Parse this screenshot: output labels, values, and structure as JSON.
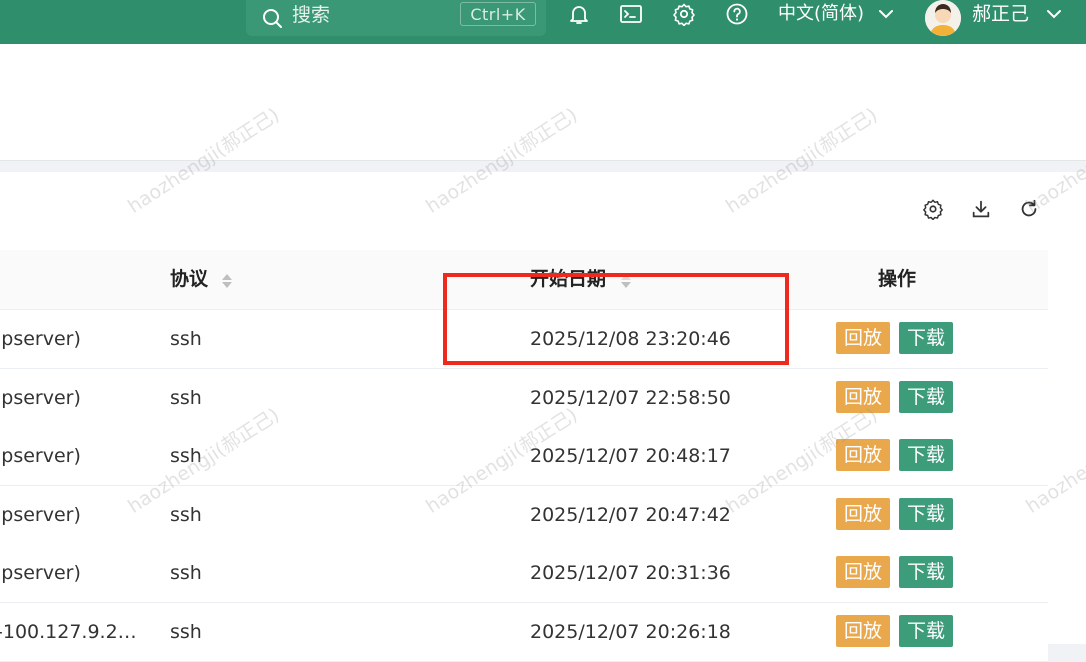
{
  "topbar": {
    "search_placeholder": "搜索",
    "search_shortcut": "Ctrl+K",
    "language": "中文(简体)",
    "username": "郝正己",
    "colors": {
      "bar": "#2f8e6c"
    }
  },
  "table": {
    "columns": {
      "protocol": "协议",
      "start_date": "开始日期",
      "actions": "操作"
    },
    "rows": [
      {
        "asset": "ıpserver)",
        "protocol": "ssh",
        "start": "2025/12/08 23:20:46"
      },
      {
        "asset": "ıpserver)",
        "protocol": "ssh",
        "start": "2025/12/07 22:58:50"
      },
      {
        "asset": "ıpserver)",
        "protocol": "ssh",
        "start": "2025/12/07 20:48:17"
      },
      {
        "asset": "ıpserver)",
        "protocol": "ssh",
        "start": "2025/12/07 20:47:42"
      },
      {
        "asset": "ıpserver)",
        "protocol": "ssh",
        "start": "2025/12/07 20:31:36"
      },
      {
        "asset": "-100.127.9.2…",
        "protocol": "ssh",
        "start": "2025/12/07 20:26:18"
      }
    ],
    "action_labels": {
      "replay": "回放",
      "download": "下载"
    },
    "colors": {
      "replay": "#e9a84c",
      "download": "#3d9c7a",
      "highlight": "#ee2a1e"
    }
  },
  "watermark": "haozhengji(郝正己)"
}
